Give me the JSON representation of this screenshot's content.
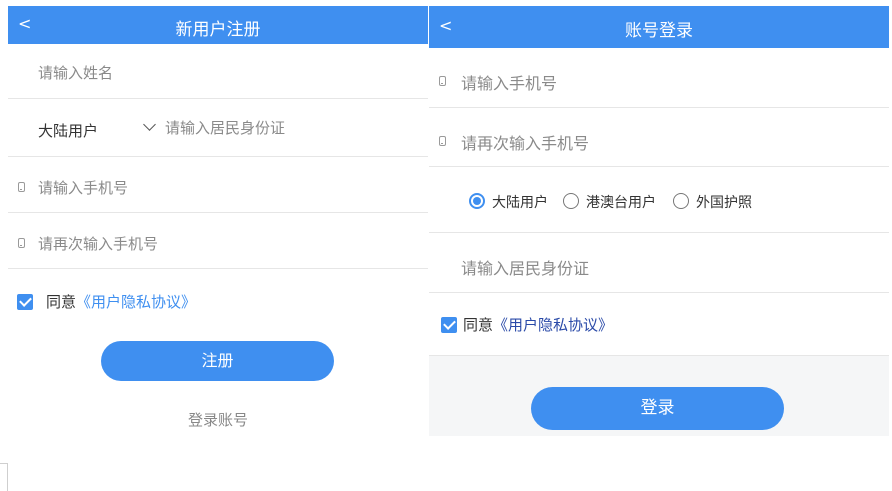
{
  "register": {
    "back": "<",
    "title": "新用户注册",
    "name_placeholder": "请输入姓名",
    "user_type": "大陆用户",
    "id_placeholder": "请输入居民身份证",
    "phone_placeholder": "请输入手机号",
    "phone_repeat_placeholder": "请再次输入手机号",
    "agree_prefix": "同意",
    "agree_link": "《用户隐私协议》",
    "agreed": true,
    "submit_label": "注册",
    "login_link": "登录账号"
  },
  "login": {
    "back": "<",
    "title": "账号登录",
    "phone_placeholder": "请输入手机号",
    "phone_repeat_placeholder": "请再次输入手机号",
    "user_types": [
      "大陆用户",
      "港澳台用户",
      "外国护照"
    ],
    "selected_user_type": "大陆用户",
    "id_placeholder": "请输入居民身份证",
    "agree_prefix": "同意",
    "agree_link": "《用户隐私协议》",
    "agreed": true,
    "submit_label": "登录"
  },
  "colors": {
    "accent": "#3f8ff0",
    "page_bg": "#f5f6f7"
  }
}
